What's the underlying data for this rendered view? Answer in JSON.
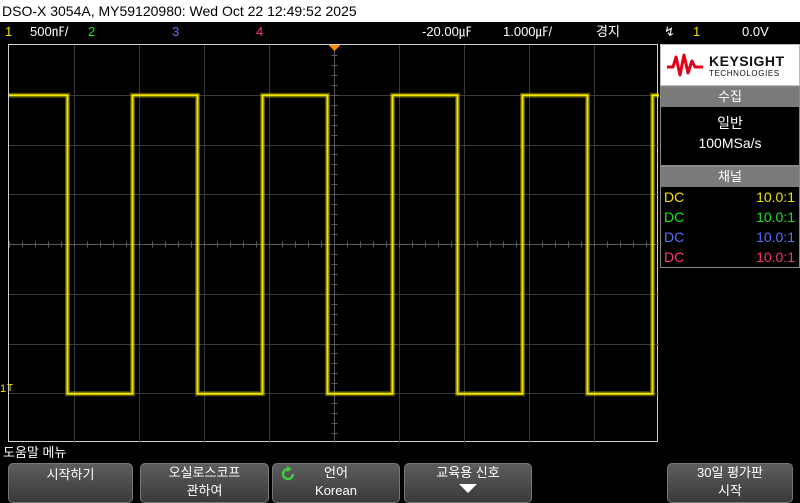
{
  "title": "DSO-X 3054A, MY59120980: Wed Oct 22 12:49:52 2025",
  "status": {
    "ch1_num": "1",
    "ch1_scale": "500㎋/",
    "ch2_num": "2",
    "ch3_num": "3",
    "ch4_num": "4",
    "time_pos": "-20.00㎌",
    "time_scale": "1.000㎌/",
    "mode": "경지",
    "trig_icon": "↯",
    "trig_src": "1",
    "trig_level": "0.0V"
  },
  "colors": {
    "ch1": "#f2e500",
    "ch2": "#19e619",
    "ch3": "#5a6dff",
    "ch4": "#ff3370",
    "trigger_marker": "#ff8c00"
  },
  "waveform": {
    "type": "square",
    "high_v": 1.5,
    "low_v": -1.5,
    "volts_per_div": 0.5,
    "period_div": 2.0,
    "first_rise_div": -0.1
  },
  "logo": {
    "brand": "KEYSIGHT",
    "sub": "TECHNOLOGIES"
  },
  "acquisition": {
    "header": "수집",
    "mode": "일반",
    "rate": "100MSa/s"
  },
  "channels_panel": {
    "header": "채널",
    "rows": [
      {
        "coupling": "DC",
        "ratio": "10.0:1"
      },
      {
        "coupling": "DC",
        "ratio": "10.0:1"
      },
      {
        "coupling": "DC",
        "ratio": "10.0:1"
      },
      {
        "coupling": "DC",
        "ratio": "10.0:1"
      }
    ]
  },
  "menu": {
    "title": "도움말 메뉴",
    "softkeys": [
      {
        "l1": "시작하기",
        "l2": ""
      },
      {
        "l1": "오실로스코프",
        "l2": "관하여"
      },
      {
        "l1": "언어",
        "l2": "Korean"
      },
      {
        "l1": "교육용 신호",
        "l2": ""
      },
      {
        "l1": "30일 평가판",
        "l2": "시작"
      }
    ]
  }
}
